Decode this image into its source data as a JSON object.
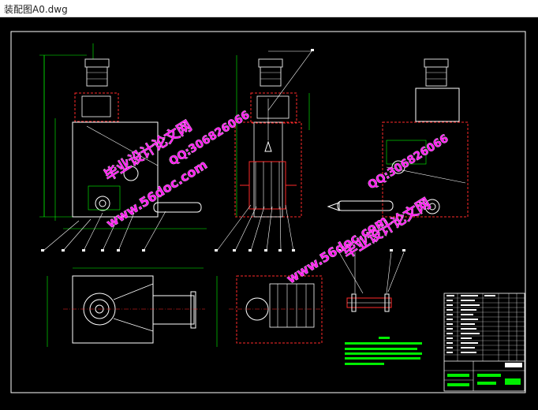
{
  "window": {
    "title": "装配图A0.dwg"
  },
  "watermarks": {
    "site_name": "毕业设计论文网",
    "url": "www.56doc.com",
    "qq": "QQ:306826066"
  },
  "colors": {
    "background": "#000000",
    "frame": "#ffffff",
    "dimension": "#00ff00",
    "hidden": "#ff2a2a",
    "leader": "#ffffff",
    "motor": "#d8d8d8",
    "note_bars": "#00ee00",
    "watermark": "#ff1cf0"
  }
}
